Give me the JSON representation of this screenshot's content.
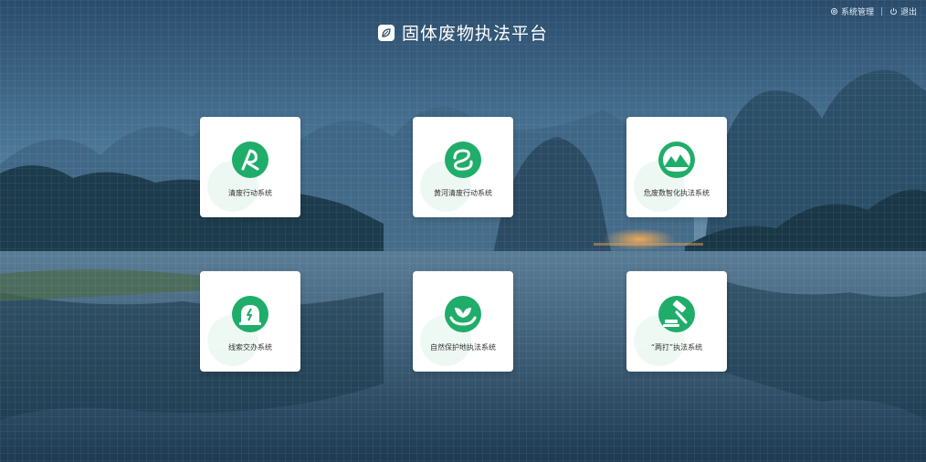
{
  "header": {
    "title": "固体废物执法平台",
    "settings_label": "系统管理",
    "logout_label": "退出"
  },
  "icons": {
    "logo": "leaf-logo-icon",
    "settings": "gear-icon",
    "logout": "power-icon"
  },
  "colors": {
    "accent": "#1fad6a",
    "card_bg": "#ffffff",
    "title_text": "#ffffff"
  },
  "systems": [
    {
      "label": "清废行动系统",
      "icon": "clean-waste-icon"
    },
    {
      "label": "黄河清废行动系统",
      "icon": "yellow-river-icon"
    },
    {
      "label": "危废数智化执法系统",
      "icon": "mountain-emblem-icon"
    },
    {
      "label": "线索交办系统",
      "icon": "alarm-bell-icon"
    },
    {
      "label": "自然保护地执法系统",
      "icon": "hand-plant-icon"
    },
    {
      "label": "“两打”执法系统",
      "icon": "gavel-icon"
    }
  ]
}
